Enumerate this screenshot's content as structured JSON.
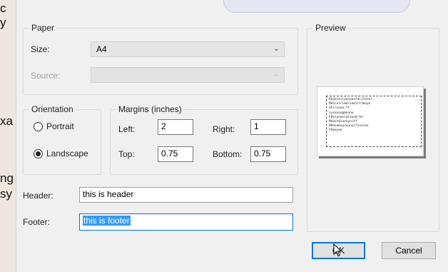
{
  "background_fragments": [
    "c",
    "y",
    "xa",
    "ng",
    "sy"
  ],
  "paper": {
    "group_label": "Paper",
    "size_label": "Size:",
    "size_value": "A4",
    "source_label": "Source:",
    "source_value": ""
  },
  "orientation": {
    "group_label": "Orientation",
    "portrait_label": "Portrait",
    "landscape_label": "Landscape",
    "selected": "Landscape"
  },
  "margins": {
    "group_label": "Margins (inches)",
    "left_label": "Left:",
    "left_value": "2",
    "right_label": "Right:",
    "right_value": "1",
    "top_label": "Top:",
    "top_value": "0.75",
    "bottom_label": "Bottom:",
    "bottom_value": "0.75"
  },
  "header": {
    "label": "Header:",
    "value": "this is header"
  },
  "footer": {
    "label": "Footer:",
    "value": "this is footer"
  },
  "preview": {
    "group_label": "Preview"
  },
  "buttons": {
    "ok": "OK",
    "cancel": "Cancel"
  },
  "colors": {
    "focus_accent": "#0078d7",
    "selection": "#3399ff",
    "dialog_bg": "#f0f0f0"
  }
}
